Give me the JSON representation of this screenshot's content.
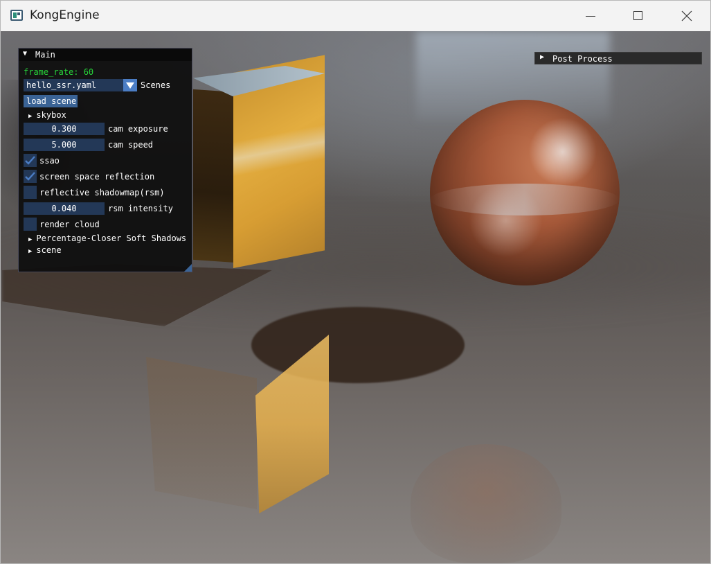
{
  "window": {
    "title": "KongEngine",
    "minimize_glyph": "minimize-icon",
    "maximize_glyph": "maximize-icon",
    "close_glyph": "close-icon"
  },
  "main_panel": {
    "title": "Main",
    "collapse_arrow": "▼",
    "frame_rate": "frame_rate: 60",
    "scene_combo": {
      "value": "hello_ssr.yaml",
      "label": "Scenes"
    },
    "load_scene_label": "load scene",
    "skybox_label": "skybox",
    "cam_exposure": {
      "value": "0.300",
      "label": "cam exposure"
    },
    "cam_speed": {
      "value": "5.000",
      "label": "cam speed"
    },
    "ssao": {
      "label": "ssao",
      "checked": true
    },
    "ssr": {
      "label": "screen space reflection",
      "checked": true
    },
    "rsm": {
      "label": "reflective shadowmap(rsm)",
      "checked": false
    },
    "rsm_intensity": {
      "value": "0.040",
      "label": "rsm intensity"
    },
    "render_cloud": {
      "label": "render cloud",
      "checked": false
    },
    "pcss_label": "Percentage-Closer Soft Shadows",
    "scene_label": "scene",
    "tree_arrow": "▶"
  },
  "post_panel": {
    "title": "Post Process",
    "arrow": "▶"
  },
  "colors": {
    "frame_rate_green": "#27d33a",
    "frame_bg": "#233857",
    "button_bg": "#3a6395",
    "check_mark": "#4b7dc4"
  }
}
